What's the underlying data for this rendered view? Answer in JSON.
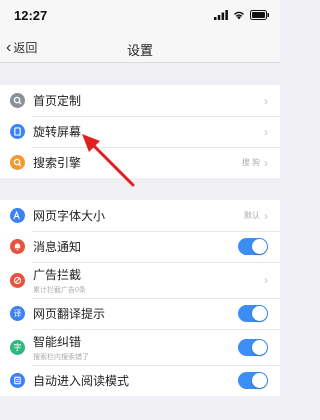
{
  "status_bar": {
    "time": "12:27"
  },
  "nav": {
    "back_label": "返回",
    "title": "设置"
  },
  "group1": [
    {
      "label": "首页定制",
      "icon": "homepage-custom-icon",
      "color": "#8a8f98"
    },
    {
      "label": "旋转屏幕",
      "icon": "rotate-screen-icon",
      "color": "#3b82f6"
    },
    {
      "label": "搜索引擎",
      "icon": "search-engine-icon",
      "color": "#f29a30",
      "value": "搜 狗"
    }
  ],
  "group2": [
    {
      "label": "网页字体大小",
      "icon": "font-size-icon",
      "color": "#3b82f6",
      "value": "默认"
    },
    {
      "label": "消息通知",
      "icon": "notification-icon",
      "color": "#e8533f",
      "toggle": true
    },
    {
      "label": "广告拦截",
      "icon": "ad-block-icon",
      "color": "#e8533f",
      "sub": "累计拦截广告0条"
    },
    {
      "label": "网页翻译提示",
      "icon": "translate-icon",
      "color": "#3b82f6",
      "toggle": true
    },
    {
      "label": "智能纠错",
      "icon": "smart-correct-icon",
      "color": "#2db87d",
      "sub": "搜索栏内搜索错了",
      "toggle": true
    },
    {
      "label": "自动进入阅读模式",
      "icon": "reading-mode-icon",
      "color": "#3b82f6",
      "toggle": true
    }
  ],
  "colors": {
    "toggle_on": "#3a8ef6",
    "annotation_arrow": "#e02020"
  }
}
